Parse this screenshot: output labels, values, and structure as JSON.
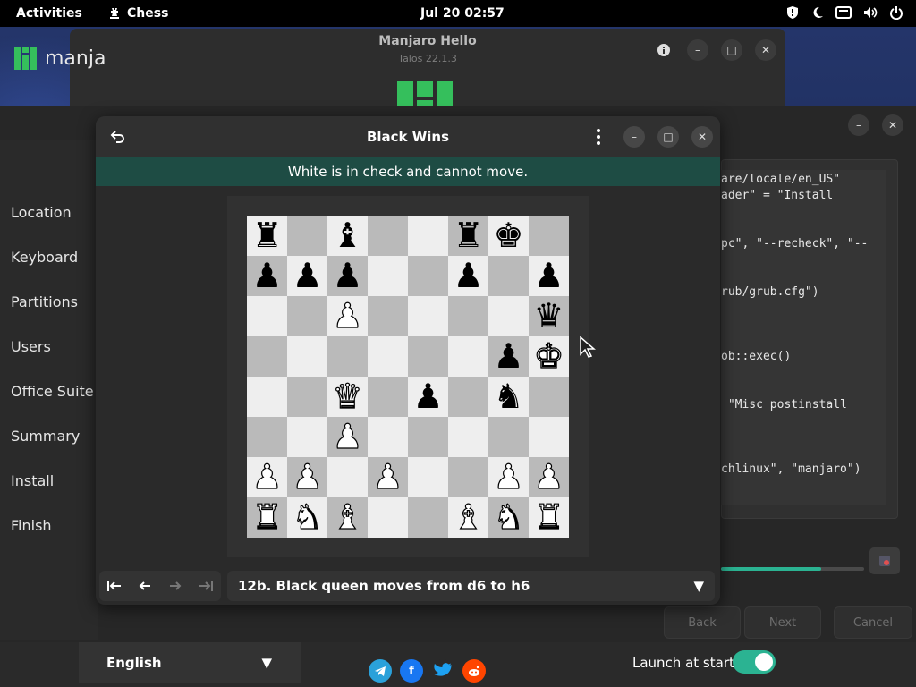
{
  "topbar": {
    "activities": "Activities",
    "app_name": "Chess",
    "clock": "Jul 20  02:57",
    "tray_icons": [
      "security-icon",
      "night-light-icon",
      "screen-icon",
      "volume-icon",
      "power-icon"
    ]
  },
  "hello": {
    "title": "Manjaro Hello",
    "subtitle": "Talos 22.1.3",
    "buttons": [
      "info-icon",
      "minimize-icon",
      "maximize-icon",
      "close-icon"
    ]
  },
  "installer": {
    "brand": "manja",
    "nav": [
      "Location",
      "Keyboard",
      "Partitions",
      "Users",
      "Office Suite",
      "Summary",
      "Install",
      "Finish"
    ],
    "log_lines": [
      "are/locale/en_US\"",
      "ader\" = \"Install",
      "pc\", \"--recheck\", \"--",
      "rub/grub.cfg\")",
      "ob::exec()",
      " \"Misc postinstall",
      "chlinux\", \"manjaro\")"
    ],
    "progress": 0.7,
    "buttons": {
      "back": "Back",
      "next": "Next",
      "cancel": "Cancel"
    }
  },
  "chess": {
    "title": "Black Wins",
    "banner": "White is in check and cannot move.",
    "board": [
      [
        "bR",
        "",
        "bB",
        "",
        "",
        "bR",
        "bK",
        ""
      ],
      [
        "bP",
        "bP",
        "bP",
        "",
        "",
        "bP",
        "",
        "bP"
      ],
      [
        "",
        "",
        "wP",
        "",
        "",
        "",
        "",
        "bQ"
      ],
      [
        "",
        "",
        "",
        "",
        "",
        "",
        "bP",
        "wK"
      ],
      [
        "",
        "",
        "wQ",
        "",
        "bP",
        "",
        "bN",
        ""
      ],
      [
        "",
        "",
        "wP",
        "",
        "",
        "",
        "",
        ""
      ],
      [
        "wP",
        "wP",
        "",
        "wP",
        "",
        "",
        "wP",
        "wP"
      ],
      [
        "wR",
        "wN",
        "wB",
        "",
        "",
        "wB",
        "wN",
        "wR"
      ]
    ],
    "move_label": "12b. Black queen moves from d6 to h6",
    "nav_buttons": [
      "first-move-icon",
      "previous-move-icon",
      "next-move-icon",
      "last-move-icon"
    ]
  },
  "bottombar": {
    "language": "English",
    "social": [
      "telegram-icon",
      "facebook-icon",
      "twitter-icon",
      "reddit-icon"
    ],
    "launch_label": "Launch at start",
    "launch_on": true
  },
  "colors": {
    "accent": "#2bb392",
    "banner": "#1e4c44",
    "light_square": "#eeeeee",
    "dark_square": "#bababa"
  }
}
